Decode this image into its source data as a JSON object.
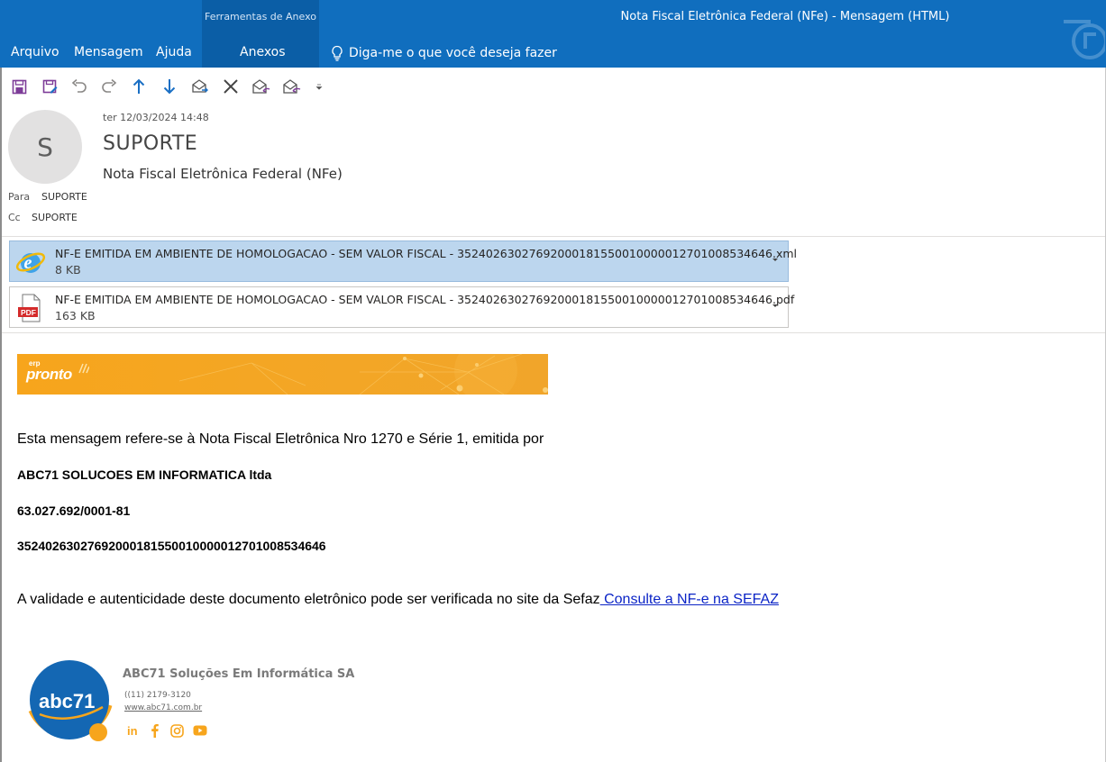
{
  "window": {
    "context_group": "Ferramentas de Anexo",
    "title": "Nota Fiscal Eletrônica Federal (NFe)  -  Mensagem (HTML)"
  },
  "menu": {
    "items": [
      "Arquivo",
      "Mensagem",
      "Ajuda",
      "Anexos"
    ],
    "tell_me": "Diga-me o que você deseja fazer"
  },
  "quick_access": {
    "icons": [
      "save-icon",
      "save-as-icon",
      "undo-icon",
      "redo-icon",
      "up-arrow-icon",
      "down-arrow-icon",
      "move-icon",
      "delete-icon",
      "reply-icon",
      "reply-all-icon",
      "customize-icon"
    ]
  },
  "message": {
    "avatar_initial": "S",
    "date": "ter 12/03/2024 14:48",
    "sender": "SUPORTE",
    "subject": "Nota Fiscal Eletrônica Federal (NFe)",
    "to_label": "Para",
    "to_value": "SUPORTE",
    "cc_label": "Cc",
    "cc_value": "SUPORTE"
  },
  "attachments": [
    {
      "name": "NF-E EMITIDA EM AMBIENTE DE HOMOLOGACAO - SEM VALOR FISCAL - 35240263027692000181550010000012701008534646.xml",
      "size": "8 KB",
      "icon": "internet-explorer-icon",
      "selected": true
    },
    {
      "name": "NF-E EMITIDA EM AMBIENTE DE HOMOLOGACAO - SEM VALOR FISCAL - 35240263027692000181550010000012701008534646.pdf",
      "size": "163 KB",
      "icon": "pdf-icon",
      "selected": false
    }
  ],
  "banner": {
    "erp": "erp",
    "brand": "pronto"
  },
  "body": {
    "intro": "Esta mensagem refere-se à Nota Fiscal Eletrônica Nro 1270 e Série 1, emitida por",
    "company": "ABC71 SOLUCOES EM INFORMATICA ltda",
    "cnpj": "63.027.692/0001-81",
    "access_key": "35240263027692000181550010000012701008534646",
    "validity_text": "A validade e autenticidade deste documento eletrônico pode ser verificada no site da Sefaz",
    "link_text": " Consulte a NF-e na SEFAZ"
  },
  "signature": {
    "logo_text": "abc71",
    "company": "ABC71 Soluções Em Informática SA",
    "phone": "((11) 2179-3120",
    "website": "www.abc71.com.br",
    "social": [
      "linkedin-icon",
      "facebook-icon",
      "instagram-icon",
      "youtube-icon"
    ]
  },
  "colors": {
    "titlebar": "#106ebe",
    "context_tab": "#0b5ea6",
    "selected_attachment": "#bcd6ee",
    "link": "#0b24c6",
    "brand_orange": "#f7a51c",
    "brand_blue": "#1467b3"
  }
}
